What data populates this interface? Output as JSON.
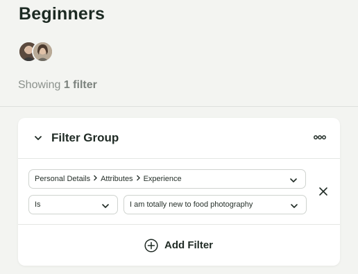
{
  "page": {
    "title": "Beginners"
  },
  "members": [
    {
      "name": "avatar-1"
    },
    {
      "name": "avatar-2"
    }
  ],
  "summary": {
    "prefix": "Showing",
    "count_label": "1 filter"
  },
  "filter_group": {
    "title": "Filter Group",
    "more_icon": "ellipsis-icon",
    "toggle_icon": "chevron-down-icon",
    "filter": {
      "path": [
        "Personal Details",
        "Attributes",
        "Experience"
      ],
      "operator": "Is",
      "value": "I am totally new to food photography"
    },
    "add_label": "Add Filter"
  },
  "colors": {
    "background": "#f3f4f1",
    "card": "#ffffff",
    "text": "#1f2a24",
    "muted": "#8b918c"
  }
}
